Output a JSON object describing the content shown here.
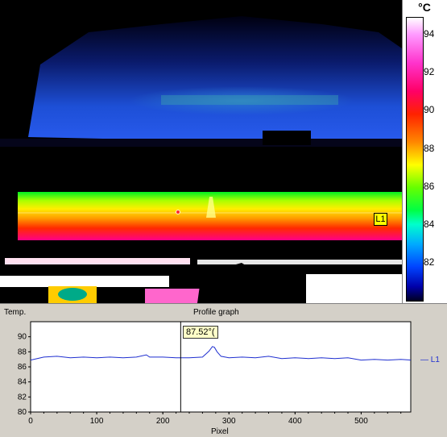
{
  "scale": {
    "unit": "°C",
    "ticks": [
      "94",
      "92",
      "90",
      "88",
      "86",
      "84",
      "82"
    ]
  },
  "image": {
    "line_label": "L1"
  },
  "profile": {
    "y_axis_label": "Temp.",
    "title": "Profile graph",
    "x_axis_label": "Pixel",
    "cursor_readout": "87.52°(",
    "legend": "— L1"
  },
  "chart_data": {
    "type": "line",
    "title": "Profile graph",
    "xlabel": "Pixel",
    "ylabel": "Temp.",
    "xlim": [
      0,
      575
    ],
    "ylim": [
      80,
      92
    ],
    "y_ticks": [
      "80",
      "82",
      "84",
      "86",
      "88",
      "90"
    ],
    "x_ticks": [
      "0",
      "100",
      "200",
      "300",
      "400",
      "500"
    ],
    "grid": false,
    "legend_position": "right",
    "cursor_x": 227,
    "series": [
      {
        "name": "L1",
        "color": "#1f2fd0",
        "x": [
          0,
          20,
          40,
          60,
          80,
          100,
          120,
          140,
          160,
          175,
          180,
          200,
          220,
          240,
          260,
          270,
          275,
          278,
          282,
          288,
          300,
          320,
          340,
          360,
          380,
          400,
          420,
          440,
          460,
          480,
          500,
          520,
          540,
          560,
          575
        ],
        "y": [
          86.9,
          87.3,
          87.4,
          87.2,
          87.3,
          87.2,
          87.3,
          87.2,
          87.3,
          87.6,
          87.3,
          87.3,
          87.2,
          87.2,
          87.3,
          88.1,
          88.7,
          88.6,
          88.0,
          87.4,
          87.2,
          87.3,
          87.2,
          87.4,
          87.1,
          87.2,
          87.1,
          87.2,
          87.1,
          87.2,
          86.9,
          87.0,
          86.9,
          87.0,
          86.9
        ]
      }
    ]
  }
}
